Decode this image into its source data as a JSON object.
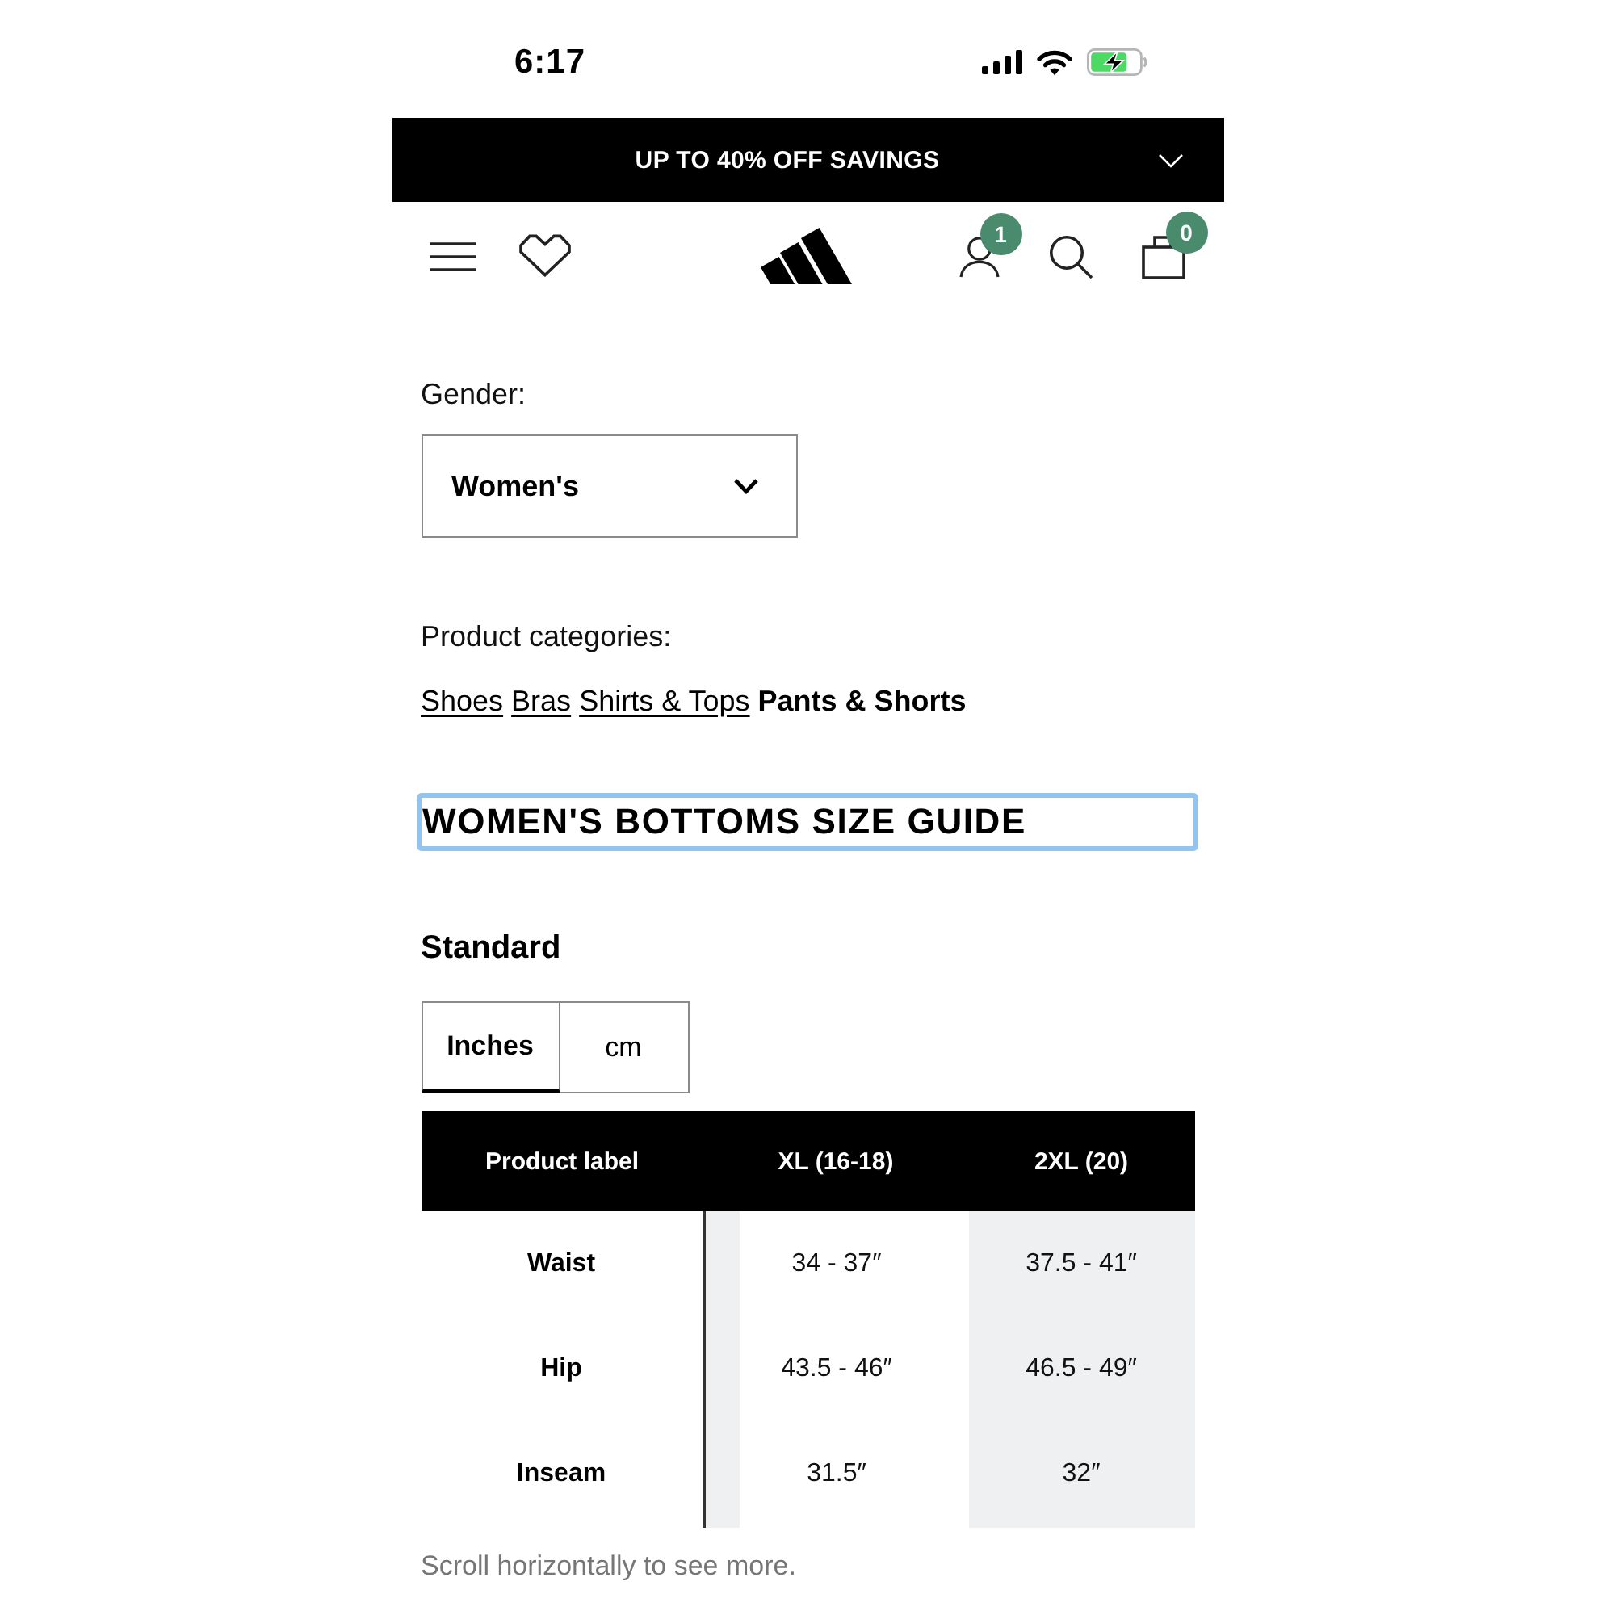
{
  "status_bar": {
    "time": "6:17"
  },
  "promo_banner": {
    "text": "UP TO 40% OFF SAVINGS"
  },
  "header": {
    "account_badge": "1",
    "bag_badge": "0"
  },
  "gender": {
    "label": "Gender:",
    "value": "Women's"
  },
  "product_categories": {
    "label": "Product categories:",
    "items": [
      {
        "label": "Shoes",
        "selected": false
      },
      {
        "label": "Bras",
        "selected": false
      },
      {
        "label": "Shirts & Tops",
        "selected": false
      },
      {
        "label": "Pants & Shorts",
        "selected": true
      }
    ]
  },
  "size_guide": {
    "title": "WOMEN'S BOTTOMS SIZE GUIDE",
    "focused": true
  },
  "standard": {
    "title": "Standard",
    "units": [
      {
        "label": "Inches",
        "selected": true
      },
      {
        "label": "cm",
        "selected": false
      }
    ]
  },
  "table": {
    "columns": [
      "Product label",
      "XL (16-18)",
      "2XL (20)"
    ],
    "rows": [
      {
        "label": "Waist",
        "values": [
          "34 - 37″",
          "37.5 - 41″"
        ]
      },
      {
        "label": "Hip",
        "values": [
          "43.5 - 46″",
          "46.5 - 49″"
        ]
      },
      {
        "label": "Inseam",
        "values": [
          "31.5″",
          "32″"
        ]
      }
    ]
  },
  "hint": "Scroll horizontally to see more."
}
